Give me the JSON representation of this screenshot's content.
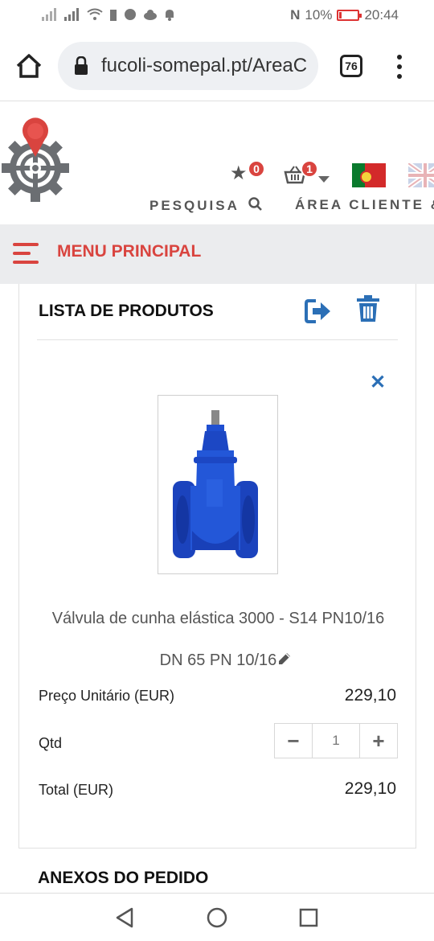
{
  "status_bar": {
    "battery": "10%",
    "time": "20:44"
  },
  "browser": {
    "url": "fucoli-somepal.pt/AreaC",
    "tab_count": "76"
  },
  "header": {
    "favorites_count": "0",
    "cart_count": "1",
    "links": {
      "search": "PESQUISA",
      "client_area": "ÁREA CLIENTE"
    }
  },
  "menu": {
    "label": "MENU PRINCIPAL"
  },
  "product_list": {
    "title": "LISTA DE PRODUTOS",
    "item": {
      "name": "Válvula de cunha elástica 3000 - S14 PN10/16",
      "variant": "DN 65 PN 10/16",
      "unit_price_label": "Preço Unitário (EUR)",
      "unit_price": "229,10",
      "qty_label": "Qtd",
      "qty": "1",
      "total_label": "Total (EUR)",
      "total": "229,10"
    }
  },
  "attachments": {
    "title": "ANEXOS DO PEDIDO"
  },
  "colors": {
    "accent_red": "#d9443f",
    "accent_blue": "#2b6fb6",
    "valve_blue": "#1f4fd1"
  }
}
